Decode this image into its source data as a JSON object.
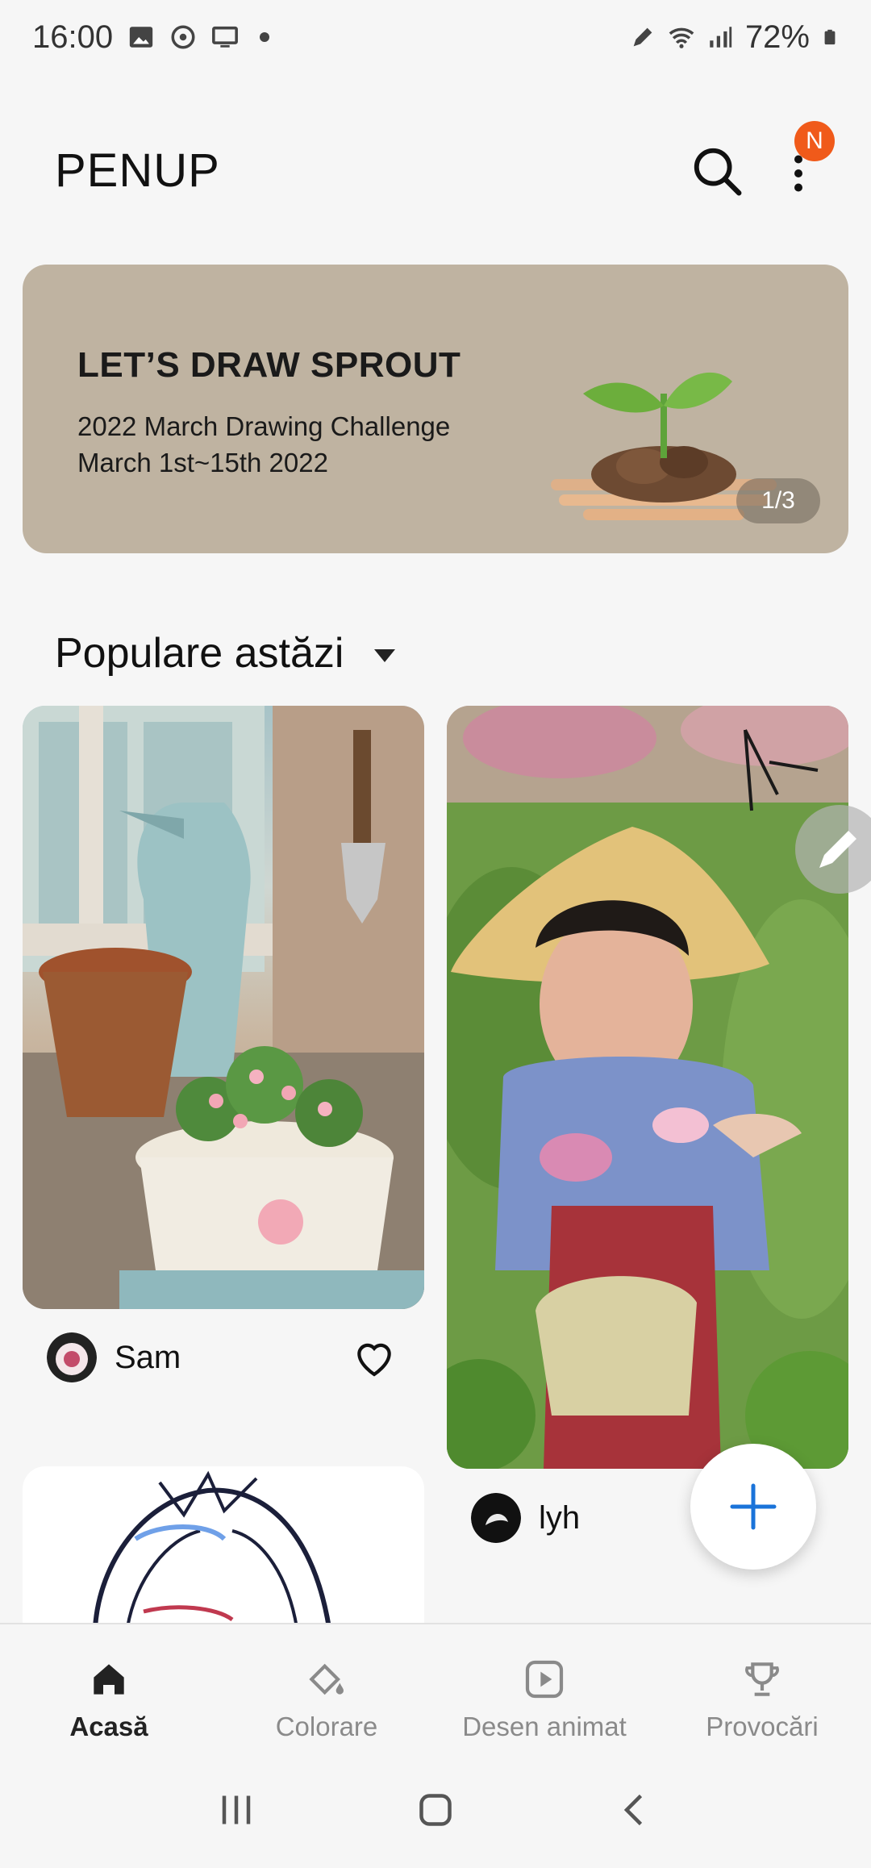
{
  "status_bar": {
    "time": "16:00",
    "battery": "72%",
    "icons": [
      "image-icon",
      "vpn-icon",
      "cast-icon",
      "dot-icon",
      "pen-icon",
      "wifi-icon",
      "signal-icon",
      "battery-icon"
    ]
  },
  "app_bar": {
    "title": "PENUP",
    "notification_badge": "N",
    "badge_color": "#f05a1a"
  },
  "banner": {
    "title": "LET’S DRAW SPROUT",
    "subtitle_line1": "2022 March Drawing Challenge",
    "subtitle_line2": "March 1st~15th 2022",
    "page_indicator": "1/3",
    "background_color": "#bfb3a1"
  },
  "section": {
    "title": "Populare astăzi"
  },
  "cards": [
    {
      "author": "Sam",
      "artwork": "pitcher-and-flowers-painting"
    },
    {
      "author": "lyh",
      "artwork": "girl-picking-tea-painting"
    },
    {
      "author": "",
      "artwork": "anime-sketch"
    }
  ],
  "fab": {
    "accent_color": "#1a73d9"
  },
  "bottom_nav": {
    "items": [
      {
        "label": "Acasă",
        "icon": "home-icon",
        "active": true
      },
      {
        "label": "Colorare",
        "icon": "paint-bucket-icon",
        "active": false
      },
      {
        "label": "Desen animat",
        "icon": "play-icon",
        "active": false
      },
      {
        "label": "Provocări",
        "icon": "trophy-icon",
        "active": false
      }
    ]
  },
  "system_nav": [
    "recents-icon",
    "home-button-icon",
    "back-icon"
  ]
}
